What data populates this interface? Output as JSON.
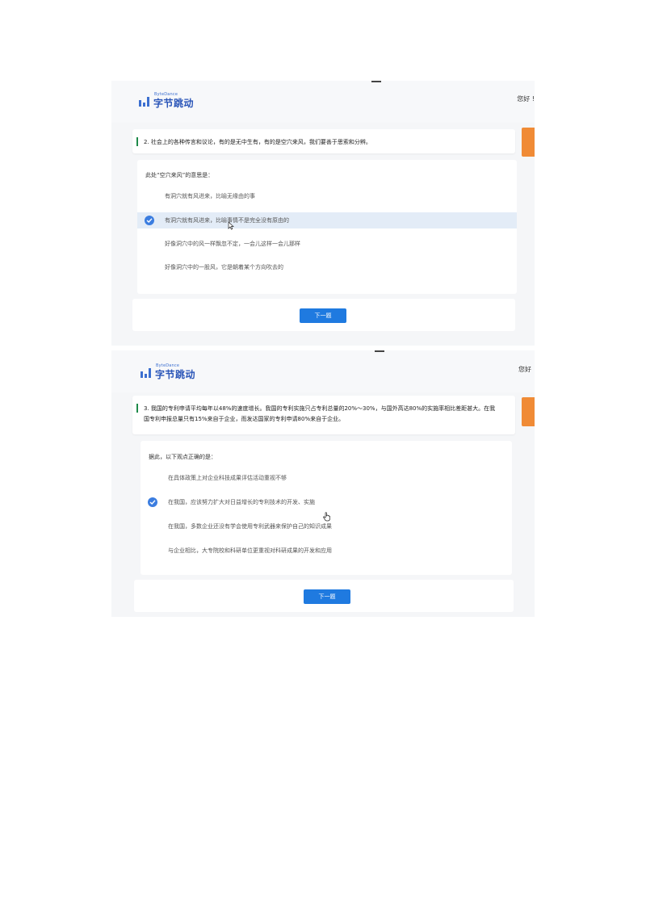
{
  "logo": {
    "small": "ByteDance",
    "text": "字节跳动"
  },
  "screens": [
    {
      "greeting": "您好 !",
      "question": "2. 社会上的各种传言和议论，有的是无中生有，有的是空穴来风，我们要善于思索和分辨。",
      "prompt": "此处“空穴来风”的意思是：",
      "options": [
        "有洞穴就有风进来，比喻无缘由的事",
        "有洞穴就有风进来，比喻事情不是完全没有原由的",
        "好像洞穴中的风一样飘忽不定，一会儿这样一会儿那样",
        "好像洞穴中的一股风，它是朝着某个方向吹去的"
      ],
      "selected_index": 1,
      "next_button": "下一题",
      "check_icon": "check-circle-icon",
      "cursor_icon": "pointer-cursor-icon"
    },
    {
      "greeting": "您好",
      "question": "3. 我国的专利申请平均每年以48%的速度增长。我国的专利实施只占专利总量的20%～30%，与国外高达80%的实施率相比差距甚大。在我国专利申报总量只有15%来自于企业，而发达国家的专利申请80%来自于企业。",
      "prompt": "据此，以下观点正确的是：",
      "options": [
        "在具体政策上对企业科技成果评估活动重视不够",
        "在我国，应该努力扩大对日益增长的专利技术的开发、实施",
        "在我国，多数企业还没有学会使用专利武器来保护自己的知识成果",
        "与企业相比，大专院校和科研单位更重视对科研成果的开发和应用"
      ],
      "selected_index": 1,
      "next_button": "下一题",
      "check_icon": "check-circle-icon",
      "cursor_icon": "hand-cursor-icon"
    }
  ],
  "colors": {
    "accent": "#1f7ae0",
    "selected_bg": "#e3ecf7",
    "question_bar": "#1e8a4a",
    "side_tab": "#f08b36"
  }
}
